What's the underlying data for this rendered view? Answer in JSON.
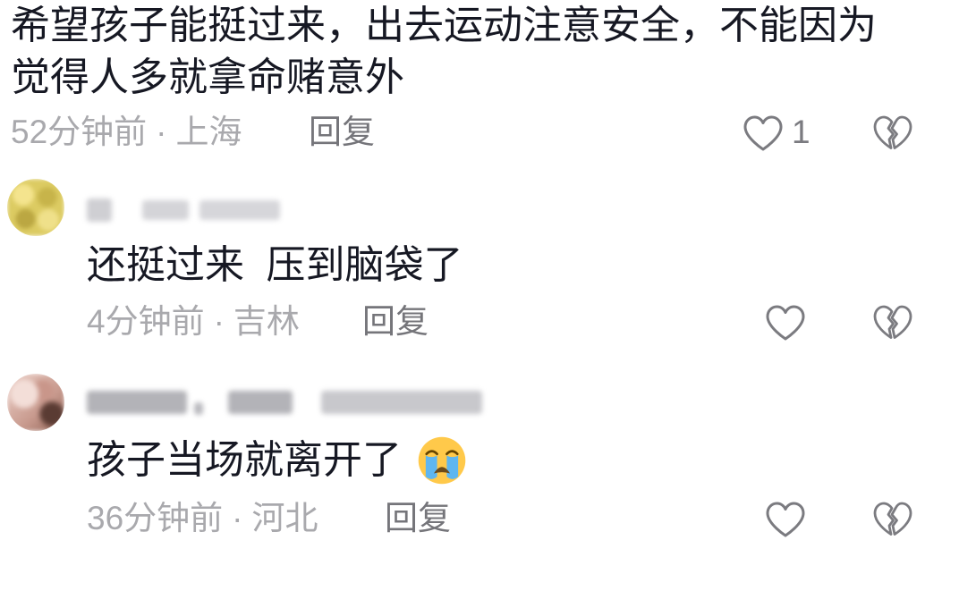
{
  "comments": [
    {
      "text": "希望孩子能挺过来，出去运动注意安全，不能因为觉得人多就拿命赌意外",
      "time": "52分钟前",
      "location": "上海",
      "like_count": "1"
    },
    {
      "text": "还挺过来  压到脑袋了",
      "time": "4分钟前",
      "location": "吉林"
    },
    {
      "text": "孩子当场就离开了",
      "emoji": "loudly-crying-face",
      "time": "36分钟前",
      "location": "河北"
    }
  ],
  "labels": {
    "reply": "回复",
    "separator": "·"
  },
  "icons": {
    "like": "heart-outline-icon",
    "dislike": "broken-heart-icon",
    "avatar": "blurred-avatar",
    "username": "blurred-username"
  },
  "colors": {
    "text": "#161823",
    "meta": "#a9a9ad",
    "reply": "#75757a",
    "icon": "#7b7b80",
    "background": "#ffffff"
  }
}
